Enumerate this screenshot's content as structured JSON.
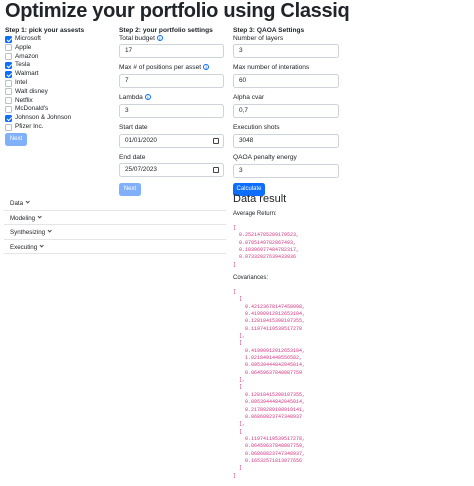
{
  "page": {
    "title": "Optimize your portfolio using Classiq"
  },
  "step1": {
    "title": "Step 1: pick your assests",
    "assets": [
      {
        "label": "Microsoft",
        "checked": true
      },
      {
        "label": "Apple",
        "checked": false
      },
      {
        "label": "Amazon",
        "checked": false
      },
      {
        "label": "Tesla",
        "checked": true
      },
      {
        "label": "Walmart",
        "checked": true
      },
      {
        "label": "Intel",
        "checked": false
      },
      {
        "label": "Walt disney",
        "checked": false
      },
      {
        "label": "Netflix",
        "checked": false
      },
      {
        "label": "McDonald's",
        "checked": false
      },
      {
        "label": "Johnson & Johnson",
        "checked": true
      },
      {
        "label": "Pfizer Inc.",
        "checked": false
      }
    ],
    "next_label": "Next"
  },
  "step2": {
    "title": "Step 2: your portfolio settings",
    "total_budget_label": "Total budget",
    "total_budget_value": "17",
    "max_positions_label": "Max # of positions per asset",
    "max_positions_value": "7",
    "lambda_label": "Lambda",
    "lambda_value": "3",
    "start_date_label": "Start date",
    "start_date_value": "01/01/2020",
    "end_date_label": "End date",
    "end_date_value": "25/07/2023",
    "next_label": "Next"
  },
  "step3": {
    "title": "Step 3: QAOA Settings",
    "layers_label": "Number of layers",
    "layers_value": "3",
    "iterations_label": "Max number of interations",
    "iterations_value": "60",
    "alpha_label": "Alpha cvar",
    "alpha_value": "0,7",
    "shots_label": "Execution shots",
    "shots_value": "3048",
    "penalty_label": "QAOA penalty energy",
    "penalty_value": "3",
    "calculate_label": "Calculate"
  },
  "accordion": [
    {
      "label": "Data"
    },
    {
      "label": "Modeling"
    },
    {
      "label": "Synthesizing"
    },
    {
      "label": "Executing"
    }
  ],
  "results": {
    "title": "Data result",
    "avg_return_label": "Average Return:",
    "avg_return": "[\n  0.25214785289179523,\n  0.0705149782867493,\n  0.18306077484782317,\n  0.07332927639433936\n]",
    "covariance_label": "Covariances:",
    "covariances": "[\n  [\n    0.42123678147458998,\n    0.41990912012653104,\n    0.12818415398107355,\n    0.11974119539517278\n  ],\n  [\n    0.41990912012653104,\n    1.0218491448556582,\n    0.09539444842045014,\n    0.06459637848087759\n  ],\n  [\n    0.12818415398107355,\n    0.09539444842045014,\n    0.21789289108919141,\n    0.06860823747348937\n  ],\n  [\n    0.11974119539517278,\n    0.06459637848087759,\n    0.06860823747348937,\n    0.16532571813077656\n  ]\n]"
  },
  "colors": {
    "primary": "#0d6efd",
    "primary_disabled": "#7fb0f9",
    "code": "#d63384"
  }
}
